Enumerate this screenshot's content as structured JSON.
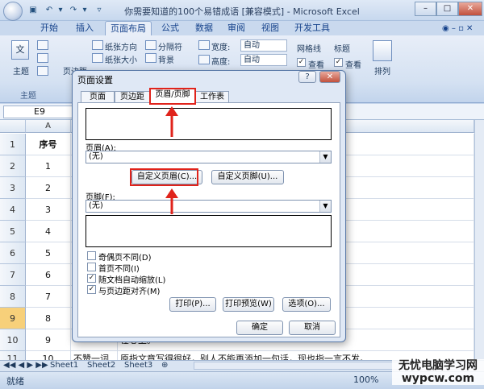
{
  "window": {
    "title": "你需要知道的100个易错成语  [兼容模式] - Microsoft Excel",
    "min": "–",
    "max": "□",
    "close": "✕"
  },
  "ribbon_tabs": [
    "开始",
    "插入",
    "页面布局",
    "公式",
    "数据",
    "审阅",
    "视图",
    "开发工具"
  ],
  "ribbon": {
    "theme_label": "主题",
    "margins_label": "页边距",
    "orientation": "纸张方向",
    "size": "纸张大小",
    "breaks": "分隔符",
    "background": "背景",
    "width_label": "宽度:",
    "width_value": "自动",
    "height_label": "高度:",
    "height_value": "自动",
    "gridlines": "网格线",
    "headings": "标题",
    "view1": "查看",
    "view2": "查看",
    "arrange": "排列"
  },
  "namebox": "E9",
  "columns": [
    "A",
    "B",
    "C"
  ],
  "rows": [
    {
      "num": "1",
      "a": "序号",
      "b": "",
      "c": ""
    },
    {
      "num": "2",
      "a": "1",
      "b": "",
      "c": "。"
    },
    {
      "num": "3",
      "a": "2",
      "b": "",
      "c": ""
    },
    {
      "num": "4",
      "a": "3",
      "b": "",
      "c": ""
    },
    {
      "num": "5",
      "a": "4",
      "b": "",
      "c": "惭念。"
    },
    {
      "num": "6",
      "a": "5",
      "b": "",
      "c": ""
    },
    {
      "num": "7",
      "a": "6",
      "b": "",
      "c": ""
    },
    {
      "num": "8",
      "a": "7",
      "b": "",
      "c": "形容贫穷。"
    },
    {
      "num": "9",
      "a": "8",
      "b": "",
      "c": "阑非听者不理解。"
    },
    {
      "num": "10",
      "a": "9",
      "b": "",
      "c": "在心上。"
    },
    {
      "num": "11",
      "a": "10",
      "b": "不赞一词",
      "c": "原指文章写得很好，别人不能再添加一句话，现也指一言不发。"
    }
  ],
  "sheet_tabs": [
    "Sheet1",
    "Sheet2",
    "Sheet3"
  ],
  "status": {
    "ready": "就绪",
    "zoom": "100%"
  },
  "watermark": {
    "line1": "无忧电脑学习网",
    "line2": "wypcw.com"
  },
  "dialog": {
    "title": "页面设置",
    "help": "?",
    "close": "✕",
    "tabs": [
      "页面",
      "页边距",
      "页眉/页脚",
      "工作表"
    ],
    "header_label": "页眉(A):",
    "header_value": "(无)",
    "custom_header": "自定义页眉(C)...",
    "custom_footer": "自定义页脚(U)...",
    "footer_label": "页脚(F):",
    "footer_value": "(无)",
    "checkboxes": [
      {
        "label": "奇偶页不同(D)",
        "checked": ""
      },
      {
        "label": "首页不同(I)",
        "checked": ""
      },
      {
        "label": "随文档自动缩放(L)",
        "checked": "✓"
      },
      {
        "label": "与页边距对齐(M)",
        "checked": "✓"
      }
    ],
    "print": "打印(P)...",
    "preview": "打印预览(W)",
    "options": "选项(O)...",
    "ok": "确定",
    "cancel": "取消"
  },
  "colors": {
    "highlight": "#e0231b",
    "selected_row": "#f7d07a"
  }
}
